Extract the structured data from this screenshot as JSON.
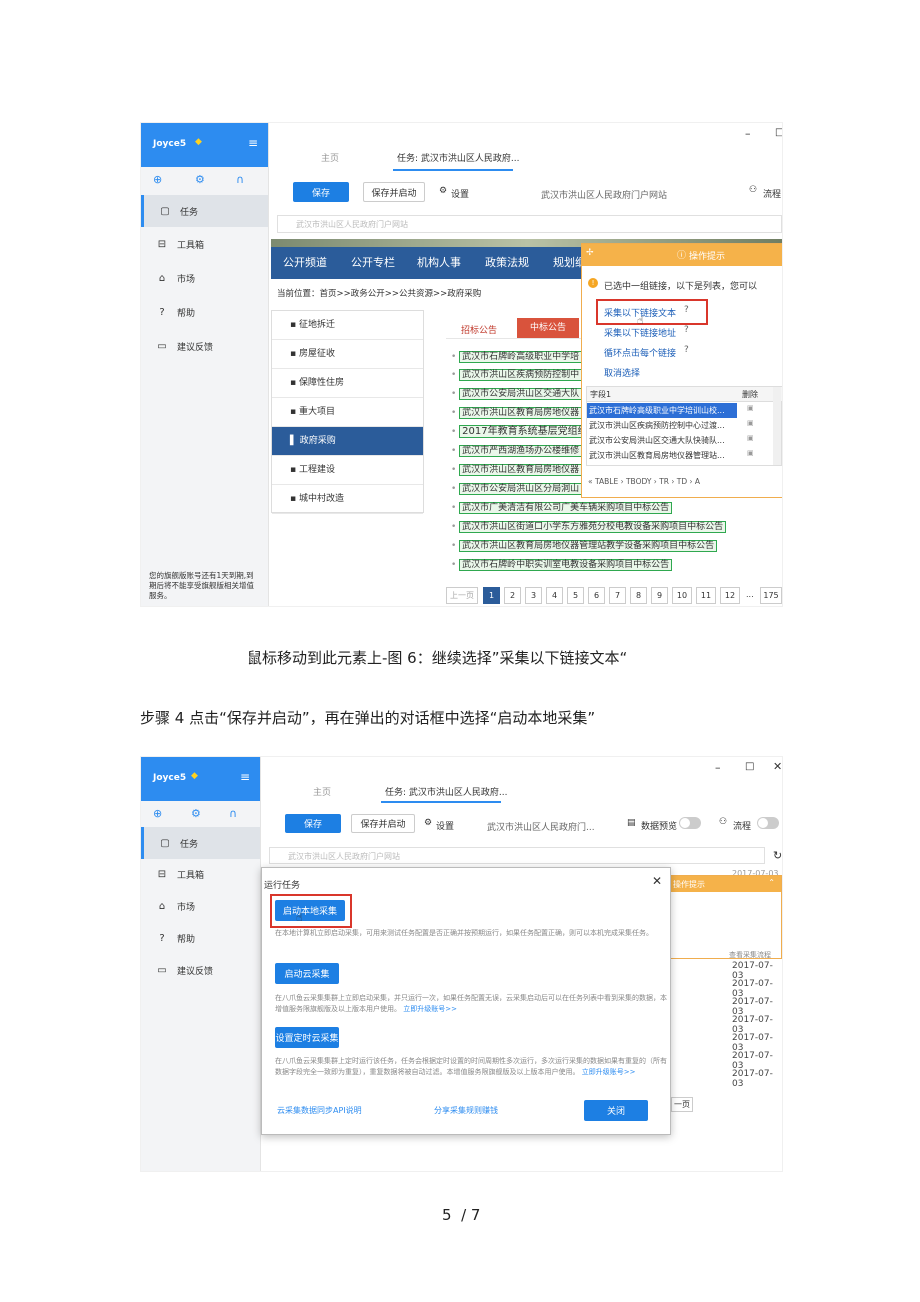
{
  "shot1": {
    "user": "Joyce5",
    "nav": [
      "任务",
      "工具箱",
      "市场",
      "帮助",
      "建议反馈"
    ],
    "tabs": {
      "home": "主页",
      "task": "任务: 武汉市洪山区人民政府..."
    },
    "toolbar": {
      "save": "保存",
      "save_start": "保存并启动",
      "settings": "设置",
      "site": "武汉市洪山区人民政府门户网站",
      "flow": "流程"
    },
    "url_placeholder": "武汉市洪山区人民政府门户网站",
    "site_nav": [
      "公开频道",
      "公开专栏",
      "机构人事",
      "政策法规",
      "规划纲"
    ],
    "breadcrumb": "当前位置：首页>>政务公开>>公共资源>>政府采购",
    "menu": [
      "征地拆迁",
      "房屋征收",
      "保障性住房",
      "重大项目",
      "政府采购",
      "工程建设",
      "城中村改造"
    ],
    "content_tabs": [
      "招标公告",
      "中标公告"
    ],
    "links": [
      "武汉市石牌岭高级职业中学培",
      "武汉市洪山区疾病预防控制中",
      "武汉市公安局洪山区交通大队",
      "武汉市洪山区教育局房地仪器",
      "2017年教育系统基层党组织书",
      "武汉市严西湖渔场办公楼维修",
      "武汉市洪山区教育局房地仪器",
      "武汉市公安局洪山区分局洞山",
      "武汉市广美清洁有限公司广美车辆采购项目中标公告",
      "武汉市洪山区街道口小学东方雅苑分校电教设备采购项目中标公告",
      "武汉市洪山区教育局房地仪器管理站教学设备采购项目中标公告",
      "武汉市石牌岭中职实训室电教设备采购项目中标公告"
    ],
    "pagination": [
      "上一页",
      "1",
      "2",
      "3",
      "4",
      "5",
      "6",
      "7",
      "8",
      "9",
      "10",
      "11",
      "12",
      "...",
      "175"
    ],
    "trial_notice": "您的旗舰版账号还有1天到期,到期后将不能享受旗舰版相关增值服务。",
    "panel": {
      "title": "操作提示",
      "info": "已选中一组链接，以下是列表，您可以",
      "options": [
        "采集以下链接文本",
        "采集以下链接地址",
        "循环点击每个链接",
        "取消选择"
      ],
      "table_header": [
        "字段1",
        "删除"
      ],
      "table_rows": [
        "武汉市石牌岭高级职业中学培训山校...",
        "武汉市洪山区疾病预防控制中心过渡...",
        "武汉市公安局洪山区交通大队快骑队...",
        "武汉市洪山区教育局房地仪器管理站..."
      ],
      "path": [
        "TABLE",
        "TBODY",
        "TR",
        "TD",
        "A"
      ]
    }
  },
  "caption1": "鼠标移动到此元素上-图 6：继续选择”采集以下链接文本“",
  "step4": "步骤 4 点击“保存并启动”，再在弹出的对话框中选择“启动本地采集”",
  "shot2": {
    "user": "Joyce5",
    "nav": [
      "任务",
      "工具箱",
      "市场",
      "帮助",
      "建议反馈"
    ],
    "tabs": {
      "home": "主页",
      "task": "任务: 武汉市洪山区人民政府..."
    },
    "toolbar": {
      "save": "保存",
      "save_start": "保存并启动",
      "settings": "设置",
      "site": "武汉市洪山区人民政府门...",
      "preview": "数据预览",
      "flow": "流程"
    },
    "url_placeholder": "武汉市洪山区人民政府门户网站",
    "dialog": {
      "title": "运行任务",
      "local_btn": "启动本地采集",
      "local_desc": "在本地计算机立即启动采集，可用来测试任务配置是否正确并按预期运行，如果任务配置正确，则可以本机完成采集任务。",
      "cloud_btn": "启动云采集",
      "cloud_desc": "在八爪鱼云采集集群上立即启动采集，并只运行一次，如果任务配置无误，云采集启动后可以在任务列表中看到采集的数据，本增值服务限旗舰版及以上版本用户使用。",
      "cloud_link": "立即升级账号>>",
      "schedule_btn": "设置定时云采集",
      "schedule_desc": "在八爪鱼云采集集群上定时运行该任务，任务会根据定时设置的时间周期性多次运行，多次运行采集的数据如果有重复的（所有数据字段完全一致即为重复），重复数据将被自动过滤。本增值服务限旗舰版及以上版本用户使用。",
      "schedule_link": "立即升级账号>>",
      "api_link": "云采集数据同步API说明",
      "share_link": "分享采集规则赚钱",
      "close": "关闭"
    },
    "bg_panel_title": "操作提示",
    "bg_flow_link": "查看采集流程",
    "dates": [
      "2017-07-03",
      "2017-07-03",
      "2017-07-03",
      "2017-07-03",
      "2017-07-03",
      "2017-07-03",
      "2017-07-03"
    ],
    "bg_date_top": "2017-07-03",
    "bg_page": "一页"
  },
  "page_number": "5  / 7"
}
